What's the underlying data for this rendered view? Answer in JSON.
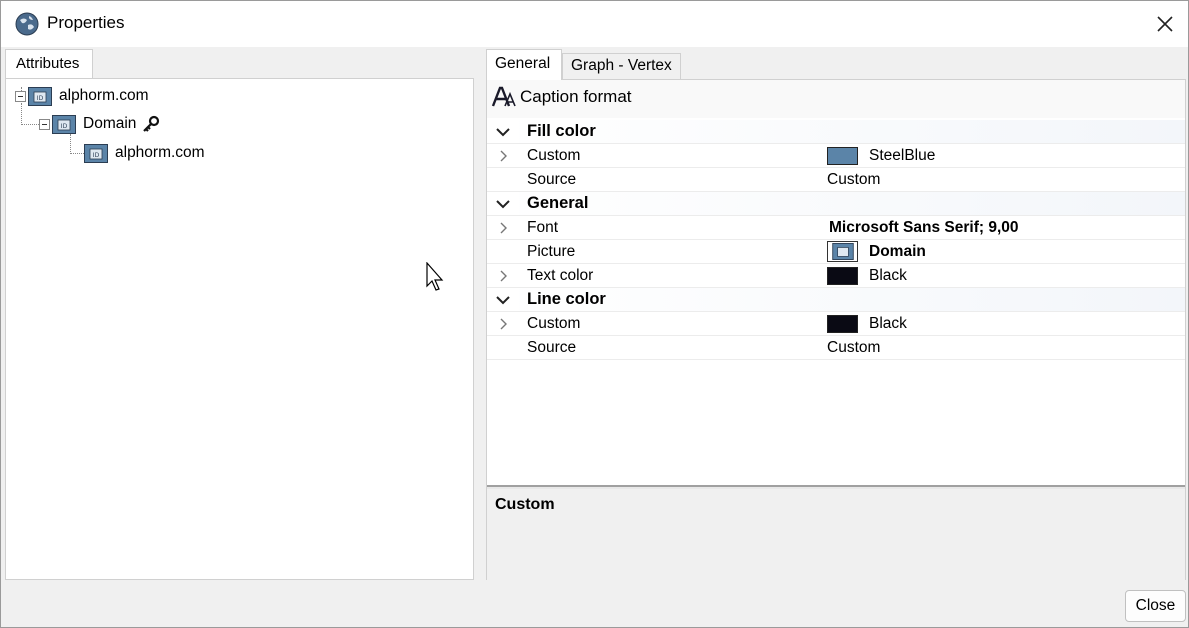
{
  "window": {
    "title": "Properties"
  },
  "left": {
    "tab_label": "Attributes",
    "tree": [
      {
        "label": "alphorm.com"
      },
      {
        "label": "Domain"
      },
      {
        "label": "alphorm.com"
      }
    ]
  },
  "right": {
    "tabs": [
      {
        "label": "General"
      },
      {
        "label": "Graph - Vertex"
      }
    ],
    "toolbar": {
      "caption_format_label": "Caption format"
    },
    "grid": {
      "fill_color": {
        "label": "Fill color",
        "custom": {
          "name": "Custom",
          "value": "SteelBlue",
          "color": "#5b84a8"
        },
        "source": {
          "name": "Source",
          "value": "Custom"
        }
      },
      "general": {
        "label": "General",
        "font": {
          "name": "Font",
          "value": "Microsoft Sans Serif; 9,00"
        },
        "picture": {
          "name": "Picture",
          "value": "Domain"
        },
        "text_color": {
          "name": "Text color",
          "value": "Black",
          "color": "#0a0a14"
        }
      },
      "line_color": {
        "label": "Line color",
        "custom": {
          "name": "Custom",
          "value": "Black",
          "color": "#0a0a14"
        },
        "source": {
          "name": "Source",
          "value": "Custom"
        }
      }
    },
    "description": {
      "title": "Custom"
    }
  },
  "footer": {
    "close_label": "Close"
  }
}
